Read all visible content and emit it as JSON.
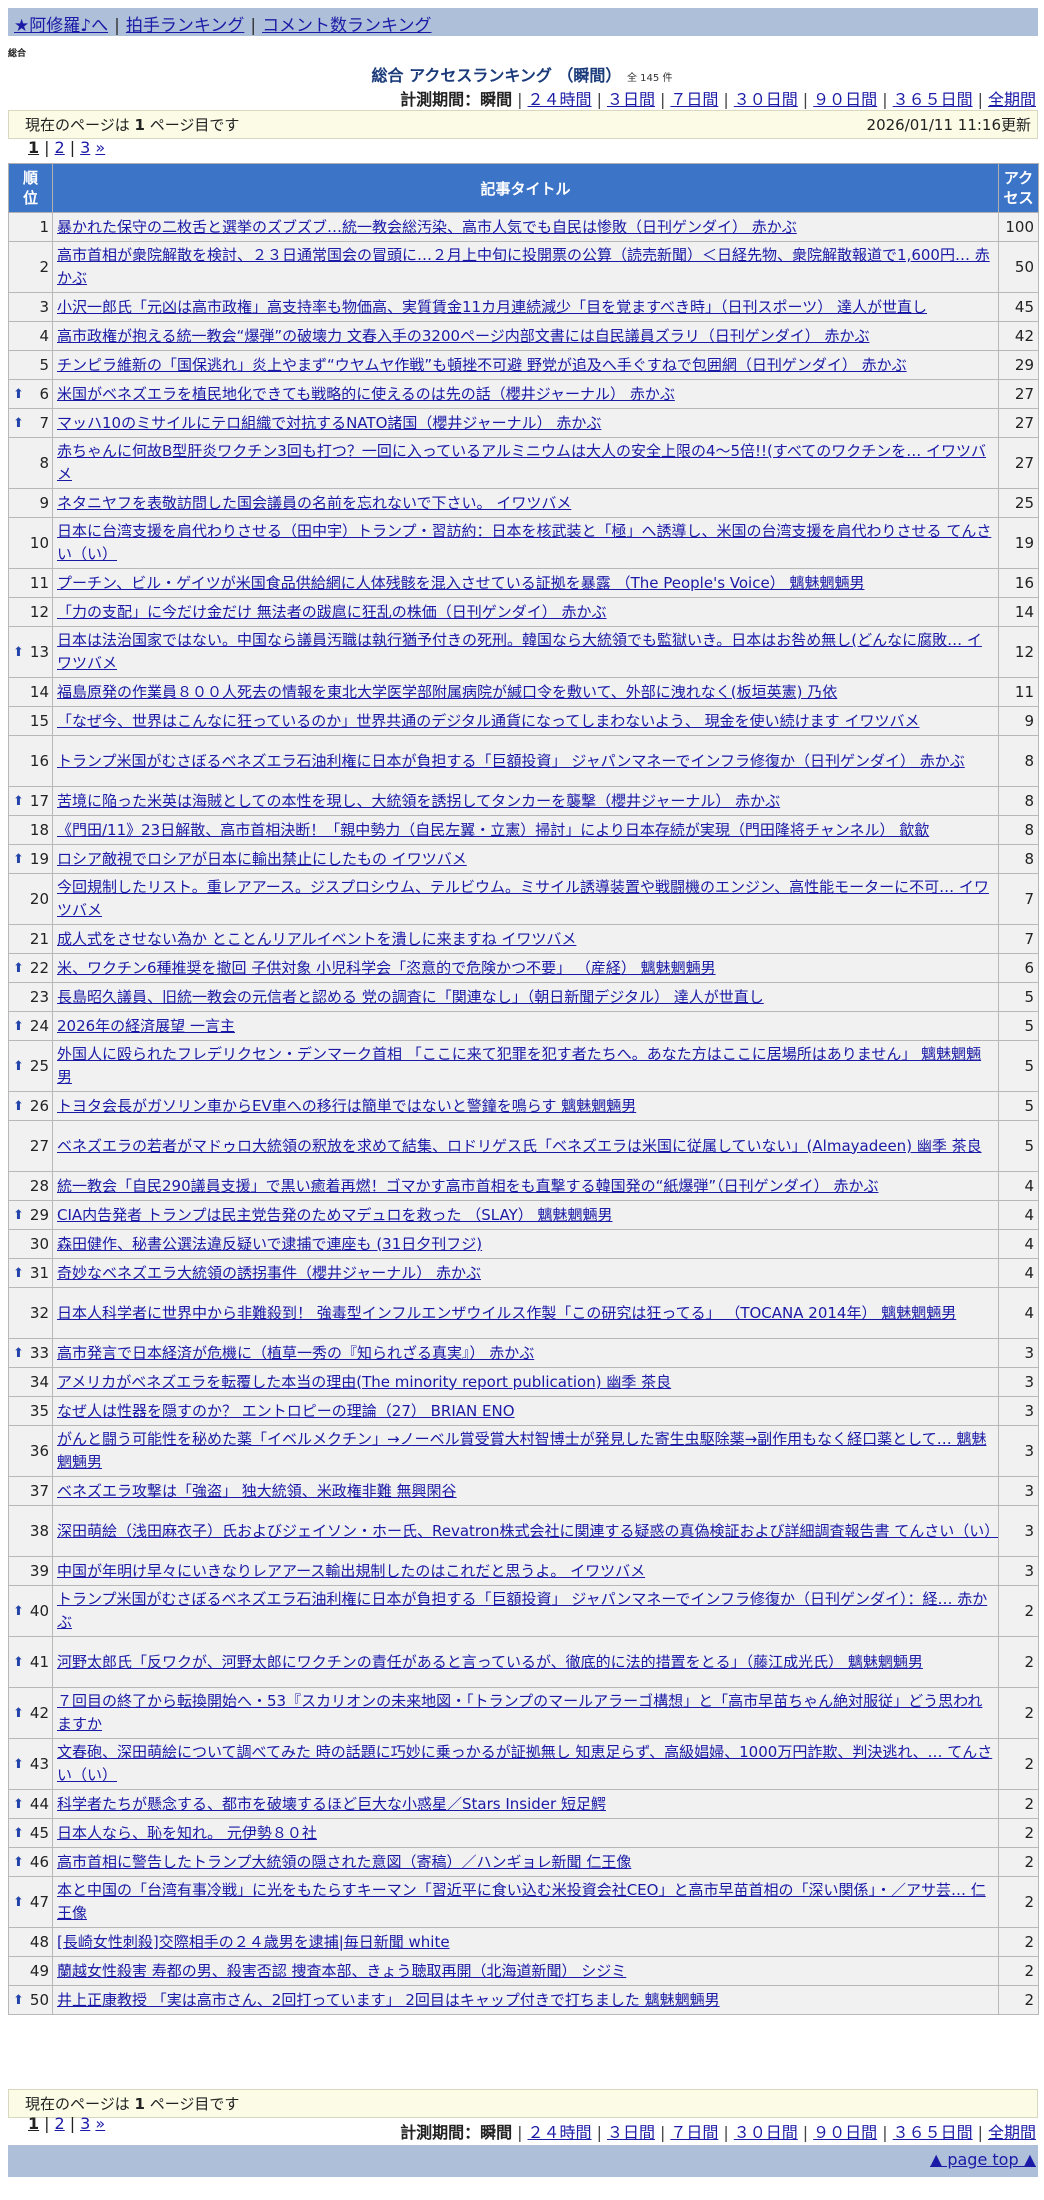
{
  "nav": {
    "home": "★阿修羅♪へ",
    "clap": "拍手ランキング",
    "comment": "コメント数ランキング",
    "sep": "|"
  },
  "category": "総合",
  "heading": {
    "title": "総合 アクセスランキング （瞬間）",
    "count": "全 145 件"
  },
  "period": {
    "label": "計測期間：",
    "items": [
      "瞬間",
      "２４時間",
      "３日間",
      "７日間",
      "３０日間",
      "９０日間",
      "３６５日間",
      "全期間"
    ],
    "sep": "|"
  },
  "page_info": {
    "prefix": "現在のページは ",
    "page": "1",
    "suffix": " ページ目です",
    "updated": "2026/01/11 11:16更新"
  },
  "pager": {
    "pages": [
      "1",
      "2",
      "3"
    ],
    "next": "»",
    "sep": "|"
  },
  "table": {
    "col_rank": "順\n位",
    "col_title": "記事タイトル",
    "col_access": "アク\nセス",
    "up_icon": "⬆",
    "rows": [
      {
        "rank": "1",
        "up": false,
        "title": "暴かれた保守の二枚舌と選挙のズブズブ…統一教会総汚染、高市人気でも自民は惨敗（日刊ゲンダイ） 赤かぶ",
        "access": "100",
        "lines": 1
      },
      {
        "rank": "2",
        "up": false,
        "title": "高市首相が衆院解散を検討、２３日通常国会の冒頭に…２月上中旬に投開票の公算（読売新聞）＜日経先物、衆院解散報道で1,600円… 赤かぶ",
        "access": "50",
        "lines": 2
      },
      {
        "rank": "3",
        "up": false,
        "title": "小沢一郎氏「元凶は高市政権」高支持率も物価高、実質賃金11カ月連続減少「目を覚ますべき時」（日刊スポーツ） 達人が世直し",
        "access": "45",
        "lines": 1
      },
      {
        "rank": "4",
        "up": false,
        "title": "高市政権が抱える統一教会“爆弾”の破壊力 文春入手の3200ページ内部文書には自民議員ズラリ（日刊ゲンダイ） 赤かぶ",
        "access": "42",
        "lines": 1
      },
      {
        "rank": "5",
        "up": false,
        "title": "チンピラ維新の「国保逃れ」炎上やまず“ウヤムヤ作戦”も頓挫不可避 野党が追及へ手ぐすねで包囲網（日刊ゲンダイ） 赤かぶ",
        "access": "29",
        "lines": 1
      },
      {
        "rank": "6",
        "up": true,
        "title": "米国がベネズエラを植民地化できても戦略的に使えるのは先の話（櫻井ジャーナル） 赤かぶ",
        "access": "27",
        "lines": 1
      },
      {
        "rank": "7",
        "up": true,
        "title": "マッハ10のミサイルにテロ組織で対抗するNATO諸国（櫻井ジャーナル） 赤かぶ",
        "access": "27",
        "lines": 1
      },
      {
        "rank": "8",
        "up": false,
        "title": "赤ちゃんに何故B型肝炎ワクチン3回も打つ？一回に入っているアルミニウムは大人の安全上限の4～5倍!!(すべてのワクチンを… イワツバメ",
        "access": "27",
        "lines": 2
      },
      {
        "rank": "9",
        "up": false,
        "title": "ネタニヤフを表敬訪問した国会議員の名前を忘れないで下さい。 イワツバメ",
        "access": "25",
        "lines": 1
      },
      {
        "rank": "10",
        "up": false,
        "title": "日本に台湾支援を肩代わりさせる（田中宇）トランプ・習訪約：日本を核武装と「極」へ誘導し、米国の台湾支援を肩代わりさせる てんさい（い）",
        "access": "19",
        "lines": 2
      },
      {
        "rank": "11",
        "up": false,
        "title": "プーチン、ビル・ゲイツが米国食品供給網に人体残骸を混入させている証拠を暴露 （The People's Voice） 魑魅魍魎男",
        "access": "16",
        "lines": 1
      },
      {
        "rank": "12",
        "up": false,
        "title": "「力の支配」に今だけ金だけ 無法者の跋扈に狂乱の株価（日刊ゲンダイ） 赤かぶ",
        "access": "14",
        "lines": 1
      },
      {
        "rank": "13",
        "up": true,
        "title": "日本は法治国家ではない。中国なら議員汚職は執行猶予付きの死刑。韓国なら大統領でも監獄いき。日本はお咎め無し(どんなに腐敗… イワツバメ",
        "access": "12",
        "lines": 2
      },
      {
        "rank": "14",
        "up": false,
        "title": "福島原発の作業員８００人死去の情報を東北大学医学部附属病院が緘口令を敷いて、外部に洩れなく(板垣英憲) 乃依",
        "access": "11",
        "lines": 1
      },
      {
        "rank": "15",
        "up": false,
        "title": "「なぜ今、世界はこんなに狂っているのか」世界共通のデジタル通貨になってしまわないよう、 現金を使い続けます イワツバメ",
        "access": "9",
        "lines": 1
      },
      {
        "rank": "16",
        "up": false,
        "title": "トランプ米国がむさぼるベネズエラ石油利権に日本が負担する「巨額投資」 ジャパンマネーでインフラ修復か（日刊ゲンダイ） 赤かぶ",
        "access": "8",
        "lines": 2
      },
      {
        "rank": "17",
        "up": true,
        "title": "苦境に陥った米英は海賊としての本性を現し、大統領を誘拐してタンカーを襲撃（櫻井ジャーナル） 赤かぶ",
        "access": "8",
        "lines": 1
      },
      {
        "rank": "18",
        "up": false,
        "title": "《門田/11》23日解散、高市首相決断！「親中勢力（自民左翼・立憲）掃討」により日本存続が実現（門田隆将チャンネル） 歙歙",
        "access": "8",
        "lines": 1
      },
      {
        "rank": "19",
        "up": true,
        "title": "ロシア敵視でロシアが日本に輸出禁止にしたもの イワツバメ",
        "access": "8",
        "lines": 1
      },
      {
        "rank": "20",
        "up": false,
        "title": "今回規制したリスト。重レアアース。ジスプロシウム、テルビウム。ミサイル誘導装置や戦闘機のエンジン、高性能モーターに不可… イワツバメ",
        "access": "7",
        "lines": 2
      },
      {
        "rank": "21",
        "up": false,
        "title": "成人式をさせない為か とことんリアルイベントを潰しに来ますね イワツバメ",
        "access": "7",
        "lines": 1
      },
      {
        "rank": "22",
        "up": true,
        "title": "米、ワクチン6種推奨を撤回 子供対象 小児科学会「恣意的で危険かつ不要」 （産経） 魑魅魍魎男",
        "access": "6",
        "lines": 1
      },
      {
        "rank": "23",
        "up": false,
        "title": "長島昭久議員、旧統一教会の元信者と認める 党の調査に「関連なし」（朝日新聞デジタル） 達人が世直し",
        "access": "5",
        "lines": 1
      },
      {
        "rank": "24",
        "up": true,
        "title": "2026年の経済展望 一言主",
        "access": "5",
        "lines": 1
      },
      {
        "rank": "25",
        "up": true,
        "title": "外国人に殴られたフレデリクセン・デンマーク首相 「ここに来て犯罪を犯す者たちへ。あなた方はここに居場所はありません」 魑魅魍魎男",
        "access": "5",
        "lines": 2
      },
      {
        "rank": "26",
        "up": true,
        "title": "トヨタ会長がガソリン車からEV車への移行は簡単ではないと警鐘を鳴らす 魑魅魍魎男",
        "access": "5",
        "lines": 1
      },
      {
        "rank": "27",
        "up": false,
        "title": "ベネズエラの若者がマドゥロ大統領の釈放を求めて結集、ロドリゲス氏「ベネズエラは米国に従属していない」(Almayadeen) 幽季 茶良",
        "access": "5",
        "lines": 2
      },
      {
        "rank": "28",
        "up": false,
        "title": "統一教会「自民290議員支援」で黒い癒着再燃！ゴマかす高市首相をも直撃する韓国発の“紙爆弾”（日刊ゲンダイ） 赤かぶ",
        "access": "4",
        "lines": 1
      },
      {
        "rank": "29",
        "up": true,
        "title": "CIA内告発者 トランプは民主党告発のためマデュロを救った （SLAY） 魑魅魍魎男",
        "access": "4",
        "lines": 1
      },
      {
        "rank": "30",
        "up": false,
        "title": "森田健作、秘書公選法違反疑いで逮捕で連座も (31日夕刊フジ)",
        "access": "4",
        "lines": 1
      },
      {
        "rank": "31",
        "up": true,
        "title": "奇妙なベネズエラ大統領の誘拐事件（櫻井ジャーナル） 赤かぶ",
        "access": "4",
        "lines": 1
      },
      {
        "rank": "32",
        "up": false,
        "title": "日本人科学者に世界中から非難殺到！ 強毒型インフルエンザウイルス作製「この研究は狂ってる」 （TOCANA 2014年） 魑魅魍魎男",
        "access": "4",
        "lines": 2
      },
      {
        "rank": "33",
        "up": true,
        "title": "高市発言で日本経済が危機に（植草一秀の『知られざる真実』） 赤かぶ",
        "access": "3",
        "lines": 1
      },
      {
        "rank": "34",
        "up": false,
        "title": "アメリカがベネズエラを転覆した本当の理由(The minority report publication) 幽季 茶良",
        "access": "3",
        "lines": 1
      },
      {
        "rank": "35",
        "up": false,
        "title": "なぜ人は性器を隠すのか？ エントロピーの理論（27） BRIAN ENO",
        "access": "3",
        "lines": 1
      },
      {
        "rank": "36",
        "up": false,
        "title": "がんと闘う可能性を秘めた薬「イベルメクチン」→ノーベル賞受賞大村智博士が発見した寄生虫駆除薬→副作用もなく経口薬として… 魑魅魍魎男",
        "access": "3",
        "lines": 2
      },
      {
        "rank": "37",
        "up": false,
        "title": "ベネズエラ攻撃は「強盗」 独大統領、米政権非難 無興閑谷",
        "access": "3",
        "lines": 1
      },
      {
        "rank": "38",
        "up": false,
        "title": "深田萌絵（浅田麻衣子）氏およびジェイソン・ホー氏、Revatron株式会社に関連する疑惑の真偽検証および詳細調査報告書 てんさい（い）",
        "access": "3",
        "lines": 2
      },
      {
        "rank": "39",
        "up": false,
        "title": "中国が年明け早々にいきなりレアアース輸出規制したのはこれだと思うよ。 イワツバメ",
        "access": "3",
        "lines": 1
      },
      {
        "rank": "40",
        "up": true,
        "title": "トランプ米国がむさぼるベネズエラ石油利権に日本が負担する「巨額投資」 ジャパンマネーでインフラ修復か（日刊ゲンダイ）：経… 赤かぶ",
        "access": "2",
        "lines": 2
      },
      {
        "rank": "41",
        "up": true,
        "title": "河野太郎氏「反ワクが、河野太郎にワクチンの責任があると言っているが、徹底的に法的措置をとる」（藤江成光氏） 魑魅魍魎男",
        "access": "2",
        "lines": 2
      },
      {
        "rank": "42",
        "up": true,
        "title": "７回目の終了から転換開始へ・53『スカリオンの未来地図・「トランプのマールアラーゴ構想」と「高市早苗ちゃん絶対服従」どう思われますか",
        "access": "2",
        "lines": 2
      },
      {
        "rank": "43",
        "up": true,
        "title": "文春砲、深田萌絵について調べてみた 時の話題に巧妙に乗っかるが証拠無し 知恵足らず、高級娼婦、1000万円詐欺、判決逃れ、… てんさい（い）",
        "access": "2",
        "lines": 2
      },
      {
        "rank": "44",
        "up": true,
        "title": "科学者たちが懸念する、都市を破壊するほど巨大な小惑星／Stars Insider 短足鰐",
        "access": "2",
        "lines": 1
      },
      {
        "rank": "45",
        "up": true,
        "title": "日本人なら、恥を知れ。 元伊勢８０社",
        "access": "2",
        "lines": 1
      },
      {
        "rank": "46",
        "up": true,
        "title": "高市首相に警告したトランプ大統領の隠された意図（寄稿）／ハンギョレ新聞 仁王像",
        "access": "2",
        "lines": 1
      },
      {
        "rank": "47",
        "up": true,
        "title": "本と中国の「台湾有事冷戦」に光をもたらすキーマン「習近平に食い込む米投資会社CEO」と高市早苗首相の「深い関係」・／アサ芸… 仁王像",
        "access": "2",
        "lines": 2
      },
      {
        "rank": "48",
        "up": false,
        "title": "[長崎女性刺殺]交際相手の２４歳男を逮捕|毎日新聞 white",
        "access": "2",
        "lines": 1
      },
      {
        "rank": "49",
        "up": false,
        "title": "蘭越女性殺害 寿都の男、殺害否認 捜査本部、きょう聴取再開（北海道新聞） シジミ",
        "access": "2",
        "lines": 1
      },
      {
        "rank": "50",
        "up": true,
        "title": "井上正康教授 「実は高市さん、2回打っています」 2回目はキャップ付きで打ちました 魑魅魍魎男",
        "access": "2",
        "lines": 1
      }
    ]
  },
  "footer": {
    "page_top": "▲ page top ▲"
  }
}
